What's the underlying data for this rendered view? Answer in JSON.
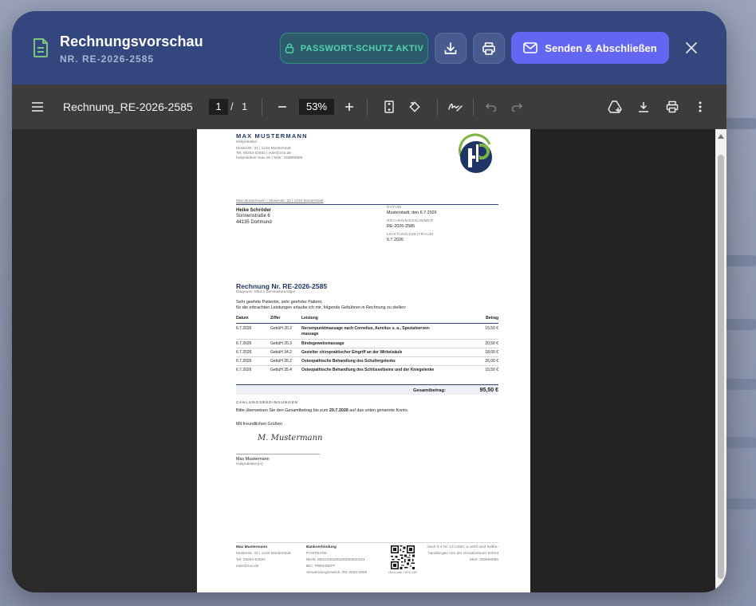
{
  "modal": {
    "title": "Rechnungsvorschau",
    "subtitle": "NR. RE-2026-2585",
    "password_badge": "PASSWORT-SCHUTZ AKTIV",
    "send_label": "Senden & Abschließen"
  },
  "pdf_toolbar": {
    "file_name": "Rechnung_RE-2026-2585",
    "page_current": "1",
    "page_sep": "/",
    "page_total": "1",
    "zoom": "53%"
  },
  "doc": {
    "practitioner_name": "MAX MUSTERMANN",
    "practitioner_role": "Heilpraktiker",
    "addr_line1": "Musterstr. 33 | 1234 Musterstadt",
    "addr_line2": "Tel: 05254 62582 | eule@zoo.de",
    "addr_line3": "heilpraktiker-max.de | StNr: 339666885",
    "sender_line": "Max Mustermann | Musterstr. 33 | 1234 Musterstadt",
    "recipient_name": "Heike Schröder",
    "recipient_street": "Sonnenstraße 6",
    "recipient_city": "44135 Dortmund",
    "label_datum": "DATUM",
    "datum": "Musterstadt, den 6.7.2026",
    "label_rechnungsnummer": "RECHNUNGSNUMMER",
    "rechnungsnummer": "RE-2026-2585",
    "label_zeitraum": "LEISTUNGSZEITRAUM",
    "zeitraum": "6.7.2026",
    "invoice_title": "Rechnung Nr. RE-2026-2585",
    "diagnose": "Diagnose: M54.2 Zervikalneuralgie",
    "salutation": "Sehr geehrte Patientin, sehr geehrter Patient,",
    "intro": "für die erbrachten Leistungen erlaube ich mir, folgende Gebühren in Rechnung zu stellen:",
    "columns": {
      "datum": "Datum",
      "ziffer": "Ziffer",
      "leistung": "Leistung",
      "betrag": "Betrag"
    },
    "rows": [
      {
        "datum": "6.7.2026",
        "ziffer": "GebüH 20.2",
        "leistung": "Nervenpunktmassage nach Cornelius, Aurelius u. a., Spezialnerven-",
        "leistung2": "massage",
        "betrag": "15,50 €"
      },
      {
        "datum": "6.7.2026",
        "ziffer": "GebüH 20.3",
        "leistung": "Bindegewebsmassage",
        "leistung2": "",
        "betrag": "20,50 €"
      },
      {
        "datum": "6.7.2026",
        "ziffer": "GebüH 34.2",
        "leistung": "Gezielter chiropraktischer Eingriff an der Wirbelsäule",
        "leistung2": "",
        "betrag": "18,00 €"
      },
      {
        "datum": "6.7.2026",
        "ziffer": "GebüH 35.2",
        "leistung": "Osteopathische Behandlung des Schultergelenks",
        "leistung2": "",
        "betrag": "26,00 €"
      },
      {
        "datum": "6.7.2026",
        "ziffer": "GebüH 35.4",
        "leistung": "Osteopathische Behandlung des Schlüsselbeins und der Kniegelenke",
        "leistung2": "",
        "betrag": "15,50 €"
      }
    ],
    "total_label": "Gesamtbetrag:",
    "total_value": "95,50 €",
    "payment_heading": "ZAHLUNGSBEDINGUNGEN",
    "payment_text_a": "Bitte überweisen Sie den Gesamtbetrag bis zum",
    "payment_date": "20.7.2026",
    "payment_text_b": "auf das unten genannte Konto.",
    "closing": "Mit freundlichen Grüßen",
    "signature": "M. Mustermann",
    "signer_name": "Max Mustermann",
    "signer_role": "Heilpraktiker(in)",
    "footer": {
      "col1_title": "Max Mustermann",
      "col1_l1": "Musterstr. 33 | 1234 Musterstadt",
      "col1_l2": "Tel: 05254 62582",
      "col1_l3": "eule@zoo.de",
      "col2_title": "Bankverbindung",
      "col2_l1": "POSTBANK",
      "col2_l2": "IBAN: DE02100100100006820101",
      "col2_l3": "BIC: PBNKDEFF",
      "col2_l4": "Verwendungszweck: RE-2026-2585",
      "qr_label": "GiroCode / EPC-QR",
      "col4_l1": "Nach § 4 Nr. 14 UStG: a USt0 sind heilbe-",
      "col4_l2": "handlungen von der Umsatzsteuer befreit",
      "col4_l3": "StNr: 339666885"
    }
  }
}
